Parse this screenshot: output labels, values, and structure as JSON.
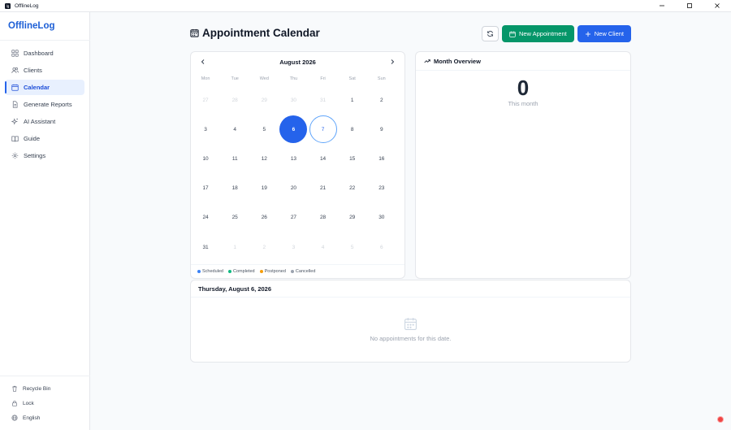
{
  "window": {
    "title": "OfflineLog"
  },
  "sidebar": {
    "brand": "OfflineLog",
    "items": [
      {
        "label": "Dashboard",
        "icon": "dashboard-icon"
      },
      {
        "label": "Clients",
        "icon": "users-icon"
      },
      {
        "label": "Calendar",
        "icon": "calendar-icon",
        "active": true
      },
      {
        "label": "Generate Reports",
        "icon": "report-icon"
      },
      {
        "label": "AI Assistant",
        "icon": "sparkle-icon"
      },
      {
        "label": "Guide",
        "icon": "book-icon"
      },
      {
        "label": "Settings",
        "icon": "gear-icon"
      }
    ],
    "bottom": [
      {
        "label": "Recycle Bin",
        "icon": "trash-icon"
      },
      {
        "label": "Lock",
        "icon": "lock-icon"
      },
      {
        "label": "English",
        "icon": "globe-icon"
      }
    ]
  },
  "header": {
    "title": "Appointment Calendar",
    "new_appointment": "New Appointment",
    "new_client": "New Client"
  },
  "calendar": {
    "month_label": "August 2026",
    "weekdays": [
      "Mon",
      "Tue",
      "Wed",
      "Thu",
      "Fri",
      "Sat",
      "Sun"
    ],
    "days": [
      {
        "d": "27",
        "m": true
      },
      {
        "d": "28",
        "m": true
      },
      {
        "d": "29",
        "m": true
      },
      {
        "d": "30",
        "m": true
      },
      {
        "d": "31",
        "m": true
      },
      {
        "d": "1"
      },
      {
        "d": "2"
      },
      {
        "d": "3"
      },
      {
        "d": "4"
      },
      {
        "d": "5"
      },
      {
        "d": "6",
        "selected": true
      },
      {
        "d": "7",
        "today": true
      },
      {
        "d": "8"
      },
      {
        "d": "9"
      },
      {
        "d": "10"
      },
      {
        "d": "11"
      },
      {
        "d": "12"
      },
      {
        "d": "13"
      },
      {
        "d": "14"
      },
      {
        "d": "15"
      },
      {
        "d": "16"
      },
      {
        "d": "17"
      },
      {
        "d": "18"
      },
      {
        "d": "19"
      },
      {
        "d": "20"
      },
      {
        "d": "21"
      },
      {
        "d": "22"
      },
      {
        "d": "23"
      },
      {
        "d": "24"
      },
      {
        "d": "25"
      },
      {
        "d": "26"
      },
      {
        "d": "27"
      },
      {
        "d": "28"
      },
      {
        "d": "29"
      },
      {
        "d": "30"
      },
      {
        "d": "31"
      },
      {
        "d": "1",
        "m": true
      },
      {
        "d": "2",
        "m": true
      },
      {
        "d": "3",
        "m": true
      },
      {
        "d": "4",
        "m": true
      },
      {
        "d": "5",
        "m": true
      },
      {
        "d": "6",
        "m": true
      }
    ],
    "legend": [
      {
        "label": "Scheduled",
        "color": "#3b82f6"
      },
      {
        "label": "Completed",
        "color": "#10b981"
      },
      {
        "label": "Postponed",
        "color": "#f59e0b"
      },
      {
        "label": "Cancelled",
        "color": "#9ca3af"
      }
    ]
  },
  "month_overview": {
    "title": "Month Overview",
    "count": "0",
    "subtitle": "This month"
  },
  "day_panel": {
    "date": "Thursday, August 6, 2026",
    "empty": "No appointments for this date."
  },
  "colors": {
    "accent": "#2563eb",
    "green": "#059669"
  }
}
